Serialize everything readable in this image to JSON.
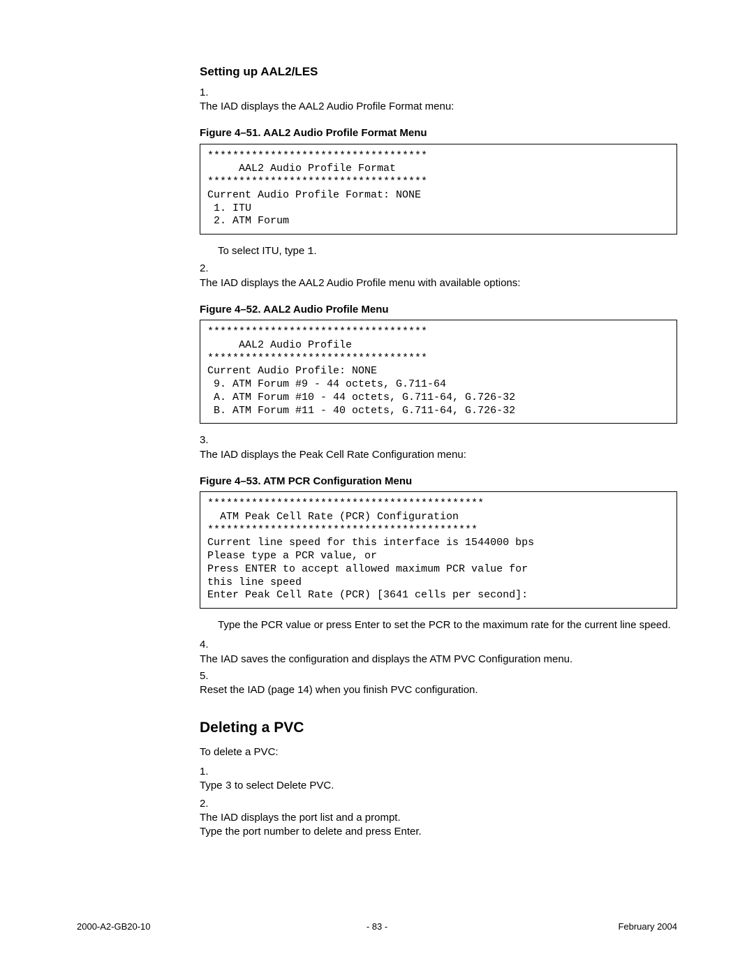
{
  "section1_title": "Setting up AAL2/LES",
  "step1": {
    "num": "1.",
    "text": "The IAD displays the AAL2 Audio Profile Format menu:"
  },
  "fig51_caption": "Figure 4–51.  AAL2 Audio Profile Format Menu",
  "fig51_code": "***********************************\n     AAL2 Audio Profile Format\n***********************************\nCurrent Audio Profile Format: NONE\n 1. ITU\n 2. ATM Forum",
  "step1b_pre": "To select ITU, type ",
  "step1b_code": "1",
  "step1b_post": ".",
  "step2": {
    "num": "2.",
    "text": "The IAD displays the AAL2 Audio Profile menu with available options:"
  },
  "fig52_caption": "Figure 4–52.  AAL2 Audio Profile Menu",
  "fig52_code": "***********************************\n     AAL2 Audio Profile\n***********************************\nCurrent Audio Profile: NONE\n 9. ATM Forum #9 - 44 octets, G.711-64\n A. ATM Forum #10 - 44 octets, G.711-64, G.726-32\n B. ATM Forum #11 - 40 octets, G.711-64, G.726-32",
  "step3": {
    "num": "3.",
    "text": "The IAD displays the Peak Cell Rate Configuration menu:"
  },
  "fig53_caption": "Figure 4–53.  ATM PCR Configuration Menu",
  "fig53_code": "********************************************\n  ATM Peak Cell Rate (PCR) Configuration\n*******************************************\nCurrent line speed for this interface is 1544000 bps\nPlease type a PCR value, or\nPress ENTER to accept allowed maximum PCR value for\nthis line speed\nEnter Peak Cell Rate (PCR) [3641 cells per second]:",
  "step3b": "Type the PCR value or press Enter to set the PCR to the maximum rate for the current line speed.",
  "step4": {
    "num": "4.",
    "text": "The IAD saves the configuration and displays the ATM PVC Configuration menu."
  },
  "step5": {
    "num": "5.",
    "text": "Reset the IAD (page 14) when you finish PVC configuration."
  },
  "section2_title": "Deleting a PVC",
  "del_intro": "To delete a PVC:",
  "del_step1": {
    "num": "1.",
    "pre": "Type ",
    "code": "3",
    "post": " to select Delete PVC."
  },
  "del_step2": {
    "num": "2.",
    "line1": "The IAD displays the port list and a prompt.",
    "line2": "Type the port number to delete and press Enter."
  },
  "footer": {
    "left": "2000-A2-GB20-10",
    "center": "- 83 -",
    "right": "February 2004"
  }
}
